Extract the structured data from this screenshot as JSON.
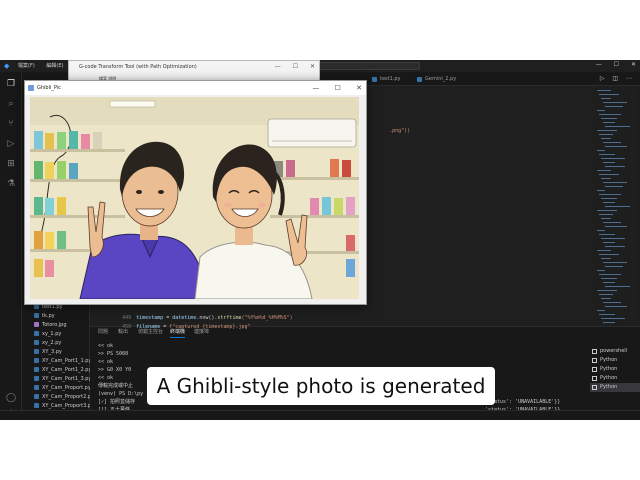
{
  "vscode": {
    "menu": [
      "檔案(F)",
      "編輯(E)"
    ],
    "search_text": "ython",
    "explorer_files": [
      {
        "name": "test1.py",
        "icon": "python-file-icon"
      },
      {
        "name": "tk.py",
        "icon": "python-file-icon"
      },
      {
        "name": "Totoro.jpg",
        "icon": "image-file-icon"
      },
      {
        "name": "xy_1.py",
        "icon": "python-file-icon"
      },
      {
        "name": "xy_2.py",
        "icon": "python-file-icon"
      },
      {
        "name": "XY_3.py",
        "icon": "python-file-icon"
      },
      {
        "name": "XY_Cam_Port1_1.py",
        "icon": "python-file-icon"
      },
      {
        "name": "XY_Cam_Port1_2.py",
        "icon": "python-file-icon"
      },
      {
        "name": "XY_Cam_Port1_3.py",
        "icon": "python-file-icon"
      },
      {
        "name": "XY_Cam_Proport.py",
        "icon": "python-file-icon"
      },
      {
        "name": "XY_Cam_Proport2.py",
        "icon": "python-file-icon"
      },
      {
        "name": "XY_Cam_Proport3.py",
        "icon": "python-file-icon"
      },
      {
        "name": "大綱",
        "icon": "chevron-right-icon"
      }
    ],
    "tabs": [
      "test1.py",
      "Gemini_2.py"
    ],
    "code_lines": [
      {
        "ln": "",
        "parts": [
          {
            "t": ".png\"))",
            "c": "str"
          }
        ]
      },
      {
        "ln": "449",
        "parts": [
          {
            "t": "timestamp",
            "c": "kw"
          },
          {
            "t": " = ",
            "c": "op"
          },
          {
            "t": "datetime",
            "c": "kw"
          },
          {
            "t": ".now().",
            "c": "op"
          },
          {
            "t": "strftime",
            "c": "fn"
          },
          {
            "t": "(\"%Y%m%d_%H%M%S\")",
            "c": "str"
          }
        ]
      },
      {
        "ln": "450",
        "parts": [
          {
            "t": "filename",
            "c": "kw"
          },
          {
            "t": " = ",
            "c": "op"
          },
          {
            "t": "f\"captured_{timestamp}.jpg\"",
            "c": "str"
          }
        ]
      }
    ],
    "panel_tabs": [
      "問題",
      "輸出",
      "偵錯主控台",
      "終端機",
      "連接埠"
    ],
    "terminal_lines": [
      "<< ok",
      ">> PS 5060",
      "<< ok",
      ">> G0 X0 Y0",
      "<< ok",
      "傳輸完成或中止",
      "(venv) PS D:\\py",
      "[✓] 拍照並儲存",
      "[!] 五十萬條",
      "[!] 查卜力風格轉換失敗：503 UNAVAILABLE. {'error': {'code': 503, 'message': 'The model is overloaded. Please try again later.', 'status': 'UNAVAILABLE'}}",
      "[!] 查卜力風格轉換失敗"
    ],
    "terminal_right": [
      "'status': 'UNAVAILABLE'}}",
      "'status': 'UNAVAILABLE'}}"
    ],
    "terminal_instances": [
      "powershell",
      "Python",
      "Python",
      "Python",
      "Python"
    ]
  },
  "gcode_window": {
    "title": "G-code Transform Tool (with Path Optimization)",
    "menu": "檔案 說明"
  },
  "ghibli_window": {
    "title": "Ghibli_Pic",
    "controls": [
      "—",
      "☐",
      "✕"
    ]
  },
  "caption": "A Ghibli-style photo is generated",
  "colors": {
    "vscode_bg": "#1e1e1e",
    "accent": "#0078d4",
    "caption_bg": "#ffffff",
    "shirt_blue": "#5a45c2"
  }
}
